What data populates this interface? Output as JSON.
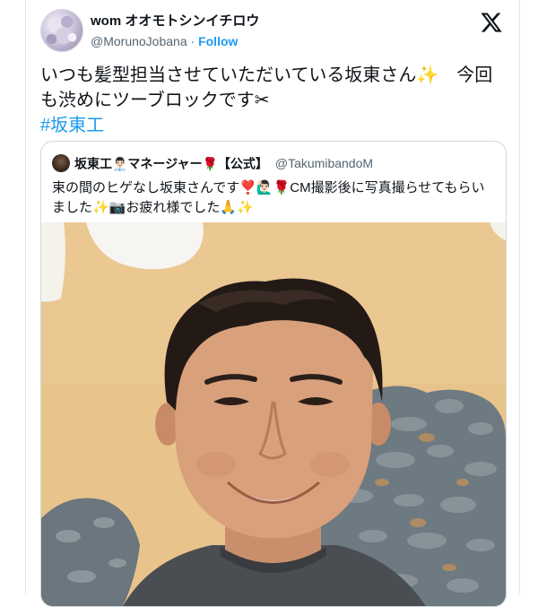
{
  "post": {
    "display_name": "wom オオモトシンイチロウ",
    "handle": "@MorunoJobana",
    "separator": " · ",
    "follow_label": "Follow",
    "text": "いつも髪型担当させていただいている坂東さん✨　今回も渋めにツーブロックです✂",
    "hashtag": "#坂東工"
  },
  "quote": {
    "display_name": "坂東工👨🏻‍💼マネージャー🌹【公式】",
    "handle": "@TakumibandoM",
    "text": "束の間のヒゲなし坂東さんです❣️🙋🏻‍♂️🌹CM撮影後に写真撮らせてもらいました✨📷お疲れ様でした🙏✨"
  },
  "icons": {
    "avatar": "profile-avatar",
    "x_logo": "x-logo-icon",
    "quote_avatar": "quote-avatar",
    "photo": "portrait-photo"
  },
  "colors": {
    "link": "#1d9bf0",
    "text": "#0f1419",
    "muted": "#536471",
    "border": "#cfd9de",
    "photo_wall": "#e8c48c",
    "photo_rock": "#6e7a82"
  }
}
